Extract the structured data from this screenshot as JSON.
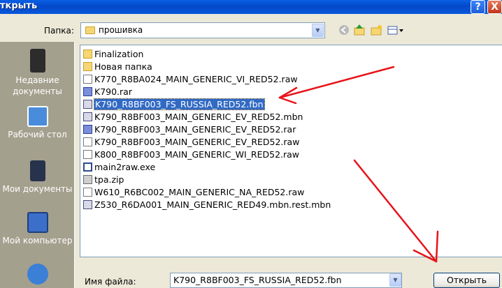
{
  "window": {
    "title": "ткрыть",
    "help_glyph": "?",
    "close_glyph": "X"
  },
  "lookin": {
    "label": "Папка:",
    "value": "прошивка"
  },
  "places": [
    {
      "line1": "Недавние",
      "line2": "документы"
    },
    {
      "line1": "Рабочий стол",
      "line2": ""
    },
    {
      "line1": "Мои документы",
      "line2": ""
    },
    {
      "line1": "Мой компьютер",
      "line2": ""
    }
  ],
  "files": [
    {
      "name": "Finalization",
      "type": "folder"
    },
    {
      "name": "Новая папка",
      "type": "folder"
    },
    {
      "name": "K770_R8BA024_MAIN_GENERIC_VI_RED52.raw",
      "type": "raw"
    },
    {
      "name": "K790.rar",
      "type": "rar"
    },
    {
      "name": "K790_R8BF003_FS_RUSSIA_RED52.fbn",
      "type": "fbn",
      "selected": true
    },
    {
      "name": "K790_R8BF003_MAIN_GENERIC_EV_RED52.mbn",
      "type": "fbn"
    },
    {
      "name": "K790_R8BF003_MAIN_GENERIC_EV_RED52.rar",
      "type": "rar"
    },
    {
      "name": "K790_R8BF003_MAIN_GENERIC_EV_RED52.raw",
      "type": "raw"
    },
    {
      "name": "K800_R8BF003_MAIN_GENERIC_WI_RED52.raw",
      "type": "raw"
    },
    {
      "name": "main2raw.exe",
      "type": "exe"
    },
    {
      "name": "tpa.zip",
      "type": "zip"
    },
    {
      "name": "W610_R6BC002_MAIN_GENERIC_NA_RED52.raw",
      "type": "raw"
    },
    {
      "name": "Z530_R6DA001_MAIN_GENERIC_RED49.mbn.rest.mbn",
      "type": "fbn"
    }
  ],
  "filename": {
    "label": "Имя файла:",
    "value": "K790_R8BF003_FS_RUSSIA_RED52.fbn"
  },
  "open_button": "Открыть"
}
